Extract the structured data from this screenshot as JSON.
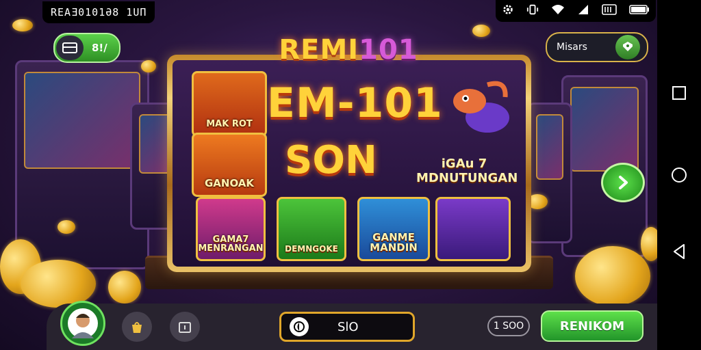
{
  "status_bar": {
    "left_text": "REAƎ0101Ə8 1UП",
    "icons": [
      "settings-icon",
      "vibrate-icon",
      "wifi-icon",
      "signal-icon",
      "sim-icon",
      "battery-icon"
    ]
  },
  "top_left_pill": {
    "icon": "wallet-icon",
    "label": "8!/"
  },
  "top_right_pill": {
    "label": "Misars",
    "icon": "shop-icon"
  },
  "logo": {
    "main": "REMI",
    "num": "101"
  },
  "banner": {
    "headline": "EM-101",
    "subline": "SON",
    "side_text": "iGAu 7 MDNUTUNGAN"
  },
  "tiles": [
    {
      "label": "MAK ROT"
    },
    {
      "label": "GANOAK"
    },
    {
      "label": "GAMA7 MENRANGAN"
    },
    {
      "label": "DEMNGOKE"
    },
    {
      "label": "GANME MANDIN"
    },
    {
      "label": ""
    }
  ],
  "bottom_bar": {
    "search_label": "SlO",
    "count_label": "1 SOO",
    "cta_label": "RENIKOM"
  },
  "colors": {
    "accent_green": "#3fbf38",
    "gold": "#f0c040",
    "bg_purple": "#2a1640"
  }
}
